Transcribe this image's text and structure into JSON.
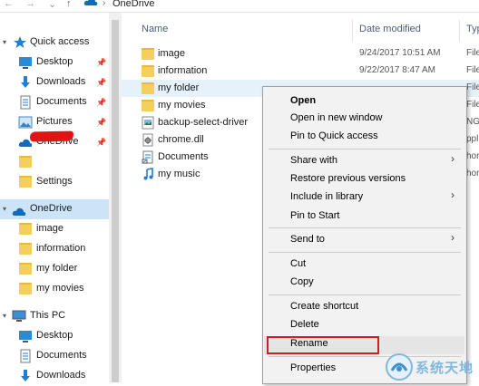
{
  "address_bar": {
    "back": "←",
    "forward": "→",
    "dropdown": "⌄",
    "up": "↑",
    "location": "OneDrive"
  },
  "sidebar": {
    "quick_access": "Quick access",
    "items": [
      {
        "label": "Desktop",
        "icon": "desktop-icon",
        "pinned": true
      },
      {
        "label": "Downloads",
        "icon": "download-icon",
        "pinned": true
      },
      {
        "label": "Documents",
        "icon": "documents-icon",
        "pinned": true
      },
      {
        "label": "Pictures",
        "icon": "pictures-icon",
        "pinned": true
      },
      {
        "label": "OneDrive",
        "icon": "onedrive-icon",
        "pinned": true
      },
      {
        "label": "",
        "icon": "folder-icon",
        "pinned": false
      },
      {
        "label": "Settings",
        "icon": "folder-icon",
        "pinned": false
      }
    ],
    "onedrive": {
      "label": "OneDrive",
      "children": [
        "image",
        "information",
        "my folder",
        "my movies"
      ]
    },
    "this_pc": {
      "label": "This PC",
      "children": [
        "Desktop",
        "Documents",
        "Downloads"
      ]
    }
  },
  "columns": {
    "name": "Name",
    "date": "Date modified",
    "type": "Type"
  },
  "files": [
    {
      "name": "image",
      "date": "9/24/2017 10:51 AM",
      "type": "File f",
      "icon": "folder-icon"
    },
    {
      "name": "information",
      "date": "9/22/2017 8:47 AM",
      "type": "File f",
      "icon": "folder-icon"
    },
    {
      "name": "my folder",
      "date": "",
      "type": "File f",
      "icon": "folder-icon"
    },
    {
      "name": "my movies",
      "date": "",
      "type": "File f",
      "icon": "folder-icon"
    },
    {
      "name": "backup-select-driver",
      "date": "",
      "type": "NG",
      "icon": "image-file-icon"
    },
    {
      "name": "chrome.dll",
      "date": "",
      "type": "ppli",
      "icon": "dll-file-icon"
    },
    {
      "name": "Documents",
      "date": "",
      "type": "hor",
      "icon": "documents-shortcut-icon"
    },
    {
      "name": "my music",
      "date": "",
      "type": "hor",
      "icon": "music-shortcut-icon"
    }
  ],
  "context_menu": {
    "open": "Open",
    "open_new_window": "Open in new window",
    "pin_quick_access": "Pin to Quick access",
    "share_with": "Share with",
    "restore_previous": "Restore previous versions",
    "include_library": "Include in library",
    "pin_start": "Pin to Start",
    "send_to": "Send to",
    "cut": "Cut",
    "copy": "Copy",
    "create_shortcut": "Create shortcut",
    "delete": "Delete",
    "rename": "Rename",
    "properties": "Properties",
    "submenu_arrow": "›"
  },
  "watermark": {
    "text": "系统天地"
  },
  "colors": {
    "selection": "#cce4f7",
    "hover_row": "#e5f1fb",
    "menu_bg": "#f2f2f2",
    "highlight_border": "#d01e26",
    "folder": "#f4cf5d",
    "onedrive_blue": "#0f6cbd"
  }
}
